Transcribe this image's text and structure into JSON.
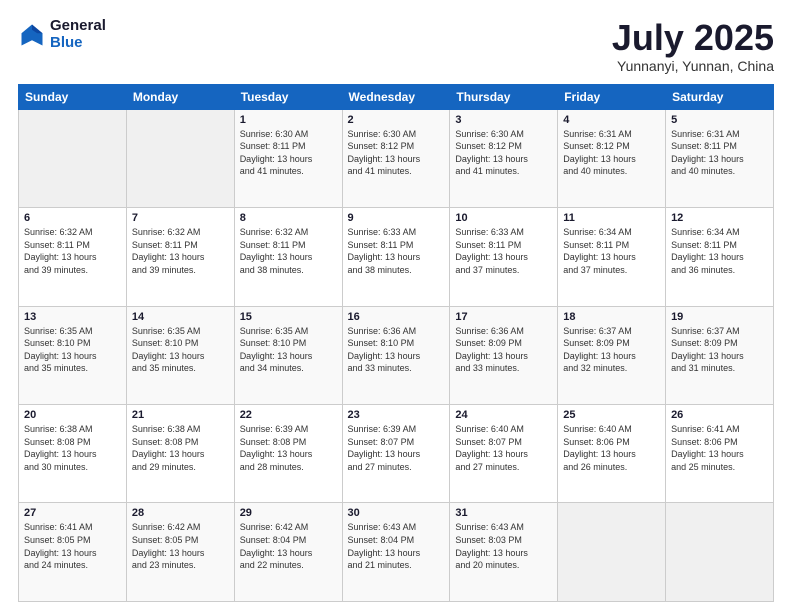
{
  "header": {
    "logo_general": "General",
    "logo_blue": "Blue",
    "month_title": "July 2025",
    "location": "Yunnanyi, Yunnan, China"
  },
  "days_of_week": [
    "Sunday",
    "Monday",
    "Tuesday",
    "Wednesday",
    "Thursday",
    "Friday",
    "Saturday"
  ],
  "weeks": [
    [
      {
        "day": "",
        "info": ""
      },
      {
        "day": "",
        "info": ""
      },
      {
        "day": "1",
        "info": "Sunrise: 6:30 AM\nSunset: 8:11 PM\nDaylight: 13 hours\nand 41 minutes."
      },
      {
        "day": "2",
        "info": "Sunrise: 6:30 AM\nSunset: 8:12 PM\nDaylight: 13 hours\nand 41 minutes."
      },
      {
        "day": "3",
        "info": "Sunrise: 6:30 AM\nSunset: 8:12 PM\nDaylight: 13 hours\nand 41 minutes."
      },
      {
        "day": "4",
        "info": "Sunrise: 6:31 AM\nSunset: 8:12 PM\nDaylight: 13 hours\nand 40 minutes."
      },
      {
        "day": "5",
        "info": "Sunrise: 6:31 AM\nSunset: 8:11 PM\nDaylight: 13 hours\nand 40 minutes."
      }
    ],
    [
      {
        "day": "6",
        "info": "Sunrise: 6:32 AM\nSunset: 8:11 PM\nDaylight: 13 hours\nand 39 minutes."
      },
      {
        "day": "7",
        "info": "Sunrise: 6:32 AM\nSunset: 8:11 PM\nDaylight: 13 hours\nand 39 minutes."
      },
      {
        "day": "8",
        "info": "Sunrise: 6:32 AM\nSunset: 8:11 PM\nDaylight: 13 hours\nand 38 minutes."
      },
      {
        "day": "9",
        "info": "Sunrise: 6:33 AM\nSunset: 8:11 PM\nDaylight: 13 hours\nand 38 minutes."
      },
      {
        "day": "10",
        "info": "Sunrise: 6:33 AM\nSunset: 8:11 PM\nDaylight: 13 hours\nand 37 minutes."
      },
      {
        "day": "11",
        "info": "Sunrise: 6:34 AM\nSunset: 8:11 PM\nDaylight: 13 hours\nand 37 minutes."
      },
      {
        "day": "12",
        "info": "Sunrise: 6:34 AM\nSunset: 8:11 PM\nDaylight: 13 hours\nand 36 minutes."
      }
    ],
    [
      {
        "day": "13",
        "info": "Sunrise: 6:35 AM\nSunset: 8:10 PM\nDaylight: 13 hours\nand 35 minutes."
      },
      {
        "day": "14",
        "info": "Sunrise: 6:35 AM\nSunset: 8:10 PM\nDaylight: 13 hours\nand 35 minutes."
      },
      {
        "day": "15",
        "info": "Sunrise: 6:35 AM\nSunset: 8:10 PM\nDaylight: 13 hours\nand 34 minutes."
      },
      {
        "day": "16",
        "info": "Sunrise: 6:36 AM\nSunset: 8:10 PM\nDaylight: 13 hours\nand 33 minutes."
      },
      {
        "day": "17",
        "info": "Sunrise: 6:36 AM\nSunset: 8:09 PM\nDaylight: 13 hours\nand 33 minutes."
      },
      {
        "day": "18",
        "info": "Sunrise: 6:37 AM\nSunset: 8:09 PM\nDaylight: 13 hours\nand 32 minutes."
      },
      {
        "day": "19",
        "info": "Sunrise: 6:37 AM\nSunset: 8:09 PM\nDaylight: 13 hours\nand 31 minutes."
      }
    ],
    [
      {
        "day": "20",
        "info": "Sunrise: 6:38 AM\nSunset: 8:08 PM\nDaylight: 13 hours\nand 30 minutes."
      },
      {
        "day": "21",
        "info": "Sunrise: 6:38 AM\nSunset: 8:08 PM\nDaylight: 13 hours\nand 29 minutes."
      },
      {
        "day": "22",
        "info": "Sunrise: 6:39 AM\nSunset: 8:08 PM\nDaylight: 13 hours\nand 28 minutes."
      },
      {
        "day": "23",
        "info": "Sunrise: 6:39 AM\nSunset: 8:07 PM\nDaylight: 13 hours\nand 27 minutes."
      },
      {
        "day": "24",
        "info": "Sunrise: 6:40 AM\nSunset: 8:07 PM\nDaylight: 13 hours\nand 27 minutes."
      },
      {
        "day": "25",
        "info": "Sunrise: 6:40 AM\nSunset: 8:06 PM\nDaylight: 13 hours\nand 26 minutes."
      },
      {
        "day": "26",
        "info": "Sunrise: 6:41 AM\nSunset: 8:06 PM\nDaylight: 13 hours\nand 25 minutes."
      }
    ],
    [
      {
        "day": "27",
        "info": "Sunrise: 6:41 AM\nSunset: 8:05 PM\nDaylight: 13 hours\nand 24 minutes."
      },
      {
        "day": "28",
        "info": "Sunrise: 6:42 AM\nSunset: 8:05 PM\nDaylight: 13 hours\nand 23 minutes."
      },
      {
        "day": "29",
        "info": "Sunrise: 6:42 AM\nSunset: 8:04 PM\nDaylight: 13 hours\nand 22 minutes."
      },
      {
        "day": "30",
        "info": "Sunrise: 6:43 AM\nSunset: 8:04 PM\nDaylight: 13 hours\nand 21 minutes."
      },
      {
        "day": "31",
        "info": "Sunrise: 6:43 AM\nSunset: 8:03 PM\nDaylight: 13 hours\nand 20 minutes."
      },
      {
        "day": "",
        "info": ""
      },
      {
        "day": "",
        "info": ""
      }
    ]
  ]
}
